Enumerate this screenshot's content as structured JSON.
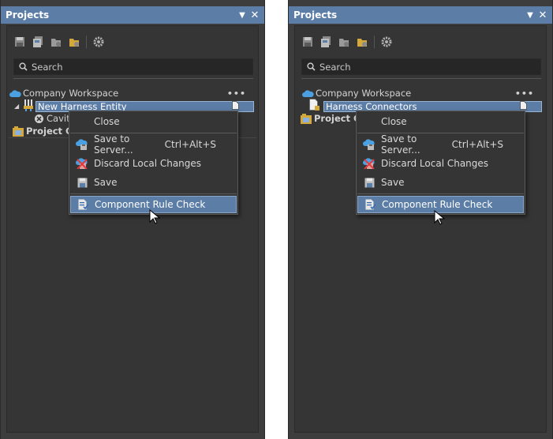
{
  "panels": [
    {
      "title": "Projects",
      "search_placeholder": "Search",
      "tree": {
        "workspace": "Company Workspace",
        "selected_item": "New Harness Entity",
        "child_item": "Cavity",
        "group_item": "Project Gr"
      },
      "menu": {
        "close": "Close",
        "save_to_server": "Save to Server...",
        "save_to_server_shortcut": "Ctrl+Alt+S",
        "discard": "Discard Local Changes",
        "save": "Save",
        "rule_check": "Component Rule Check"
      }
    },
    {
      "title": "Projects",
      "search_placeholder": "Search",
      "tree": {
        "workspace": "Company Workspace",
        "selected_item": "Harness Connectors",
        "group_item": "Project Gr"
      },
      "menu": {
        "close": "Close",
        "save_to_server": "Save to Server...",
        "save_to_server_shortcut": "Ctrl+Alt+S",
        "discard": "Discard Local Changes",
        "save": "Save",
        "rule_check": "Component Rule Check"
      }
    }
  ],
  "colors": {
    "titlebar": "#5b7da6",
    "panel_bg": "#3d3d3d",
    "inner_bg": "#353535",
    "highlight": "#5b7da6"
  }
}
